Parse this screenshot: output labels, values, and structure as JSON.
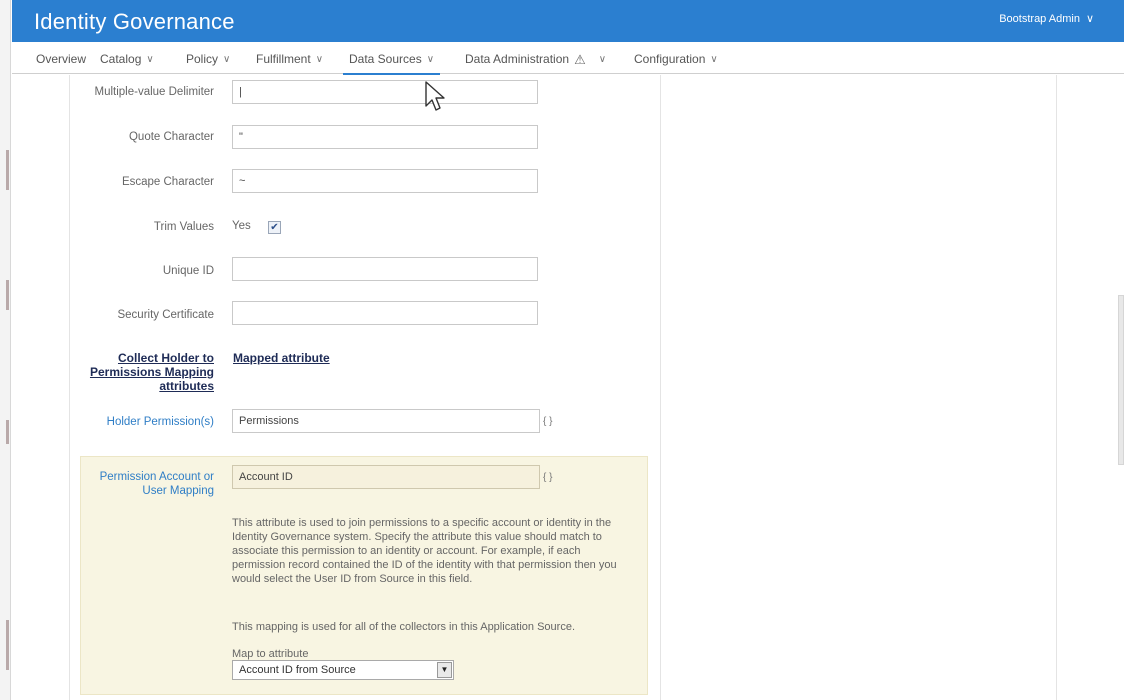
{
  "header": {
    "app_title": "Identity Governance",
    "user_menu": "Bootstrap Admin",
    "brand_color": "#2b7fd0"
  },
  "nav": {
    "items": [
      {
        "label": "Overview",
        "has_menu": false
      },
      {
        "label": "Catalog",
        "has_menu": true
      },
      {
        "label": "Policy",
        "has_menu": true
      },
      {
        "label": "Fulfillment",
        "has_menu": true
      },
      {
        "label": "Data Sources",
        "has_menu": true,
        "active": true
      },
      {
        "label": "Data Administration",
        "has_menu": true,
        "icon": "warning-icon"
      },
      {
        "label": "Configuration",
        "has_menu": true
      }
    ]
  },
  "form": {
    "multiple_value_delimiter": {
      "label": "Multiple-value Delimiter",
      "value": "|"
    },
    "quote_character": {
      "label": "Quote Character",
      "value": "\""
    },
    "escape_character": {
      "label": "Escape Character",
      "value": "~"
    },
    "trim_values": {
      "label": "Trim Values",
      "option": "Yes",
      "checked": true
    },
    "unique_id": {
      "label": "Unique ID",
      "value": ""
    },
    "security_certificate": {
      "label": "Security Certificate",
      "value": ""
    },
    "mapping_section": {
      "left_heading": "Collect Holder to Permissions Mapping attributes",
      "right_heading": "Mapped attribute"
    },
    "holder_permissions": {
      "label": "Holder Permission(s)",
      "value": "Permissions",
      "braces": "{ }"
    },
    "permission_account": {
      "label": "Permission Account or User Mapping",
      "value": "Account ID",
      "braces": "{ }",
      "help_1": "This attribute is used to join permissions to a specific account or identity in the Identity Governance system. Specify the attribute this value should match to associate this permission to an identity or account. For example, if each permission record contained the ID of the identity with that permission then you would select the User ID from Source in this field.",
      "help_2": "This mapping is used for all of the collectors in this Application Source.",
      "map_label": "Map to attribute",
      "map_value": "Account ID from Source"
    }
  }
}
